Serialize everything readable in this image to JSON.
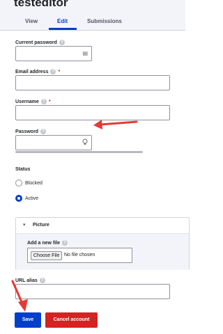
{
  "header": {
    "title": "testeditor",
    "tabs": [
      {
        "label": "View"
      },
      {
        "label": "Edit"
      },
      {
        "label": "Submissions"
      }
    ]
  },
  "form": {
    "current_password": {
      "label": "Current password",
      "help": "?"
    },
    "email": {
      "label": "Email address",
      "help": "?",
      "required_mark": "*"
    },
    "username": {
      "label": "Username",
      "help": "?",
      "required_mark": "*"
    },
    "password": {
      "label": "Password",
      "help": "?"
    },
    "status": {
      "label": "Status",
      "options": [
        {
          "label": "Blocked",
          "selected": false
        },
        {
          "label": "Active",
          "selected": true
        }
      ]
    },
    "picture": {
      "summary": "Picture",
      "chevron": "▾",
      "add_label": "Add a new file",
      "help": "?",
      "choose_button": "Choose File",
      "no_file_text": "No file chosen"
    },
    "url_alias": {
      "label": "URL alias",
      "help": "?"
    },
    "actions": {
      "save_label": "Save",
      "cancel_label": "Cancel account"
    }
  },
  "annotations": {
    "arrow_color": "#e53935"
  },
  "colors": {
    "accent": "#003ecc",
    "danger": "#d72222",
    "header_bg": "#f3f4f9"
  },
  "icons": {
    "password_manager": "key-card-icon",
    "password_reveal": "bulb-icon"
  }
}
